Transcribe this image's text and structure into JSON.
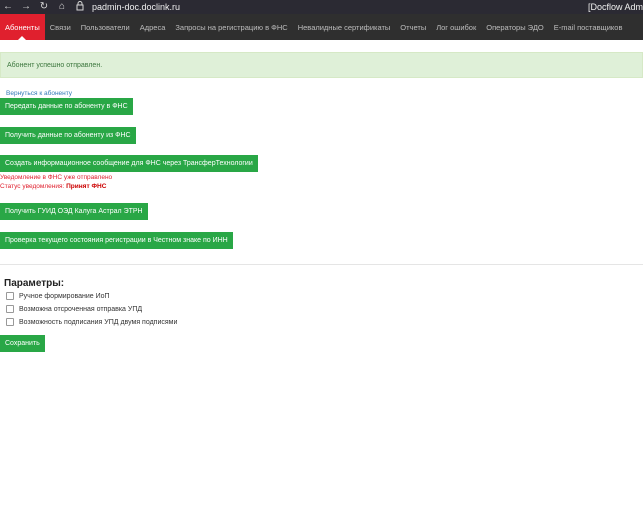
{
  "browser": {
    "url": "padmin-doc.doclink.ru",
    "tab_title": "[Docflow Adm"
  },
  "nav": {
    "items": [
      {
        "label": "Абоненты"
      },
      {
        "label": "Связи"
      },
      {
        "label": "Пользователи"
      },
      {
        "label": "Адреса"
      },
      {
        "label": "Запросы на регистрацию в ФНС"
      },
      {
        "label": "Невалидные сертификаты"
      },
      {
        "label": "Отчеты"
      },
      {
        "label": "Лог ошибок"
      },
      {
        "label": "Операторы ЭДО"
      },
      {
        "label": "E-mail поставщиков"
      }
    ]
  },
  "alert": {
    "text": "Абонент успешно отправлен."
  },
  "actions": {
    "back_link": "Вернуться к абоненту",
    "send_fns": "Передать данные по абоненту в ФНС",
    "get_fns": "Получить данные по абоненту из ФНС",
    "create_msg": "Создать информационное сообщение для ФНС через ТрансферТехнологии",
    "notice_sent": "Уведомление в ФНС уже отправлено",
    "status_label": "Статус уведомления:",
    "status_value": "Принят ФНС",
    "get_guid": "Получить ГУИД ОЭД Калуга Астрал ЭТРН",
    "check_status": "Проверка текущего состояния регистрации в Честном знаке по ИНН"
  },
  "params": {
    "title": "Параметры:",
    "options": [
      {
        "label": "Ручное формирование ИоП",
        "checked": false
      },
      {
        "label": "Возможна отсроченная отправка УПД",
        "checked": false
      },
      {
        "label": "Возможность подписания УПД двумя подписями",
        "checked": false
      }
    ],
    "save_label": "Сохранить"
  }
}
